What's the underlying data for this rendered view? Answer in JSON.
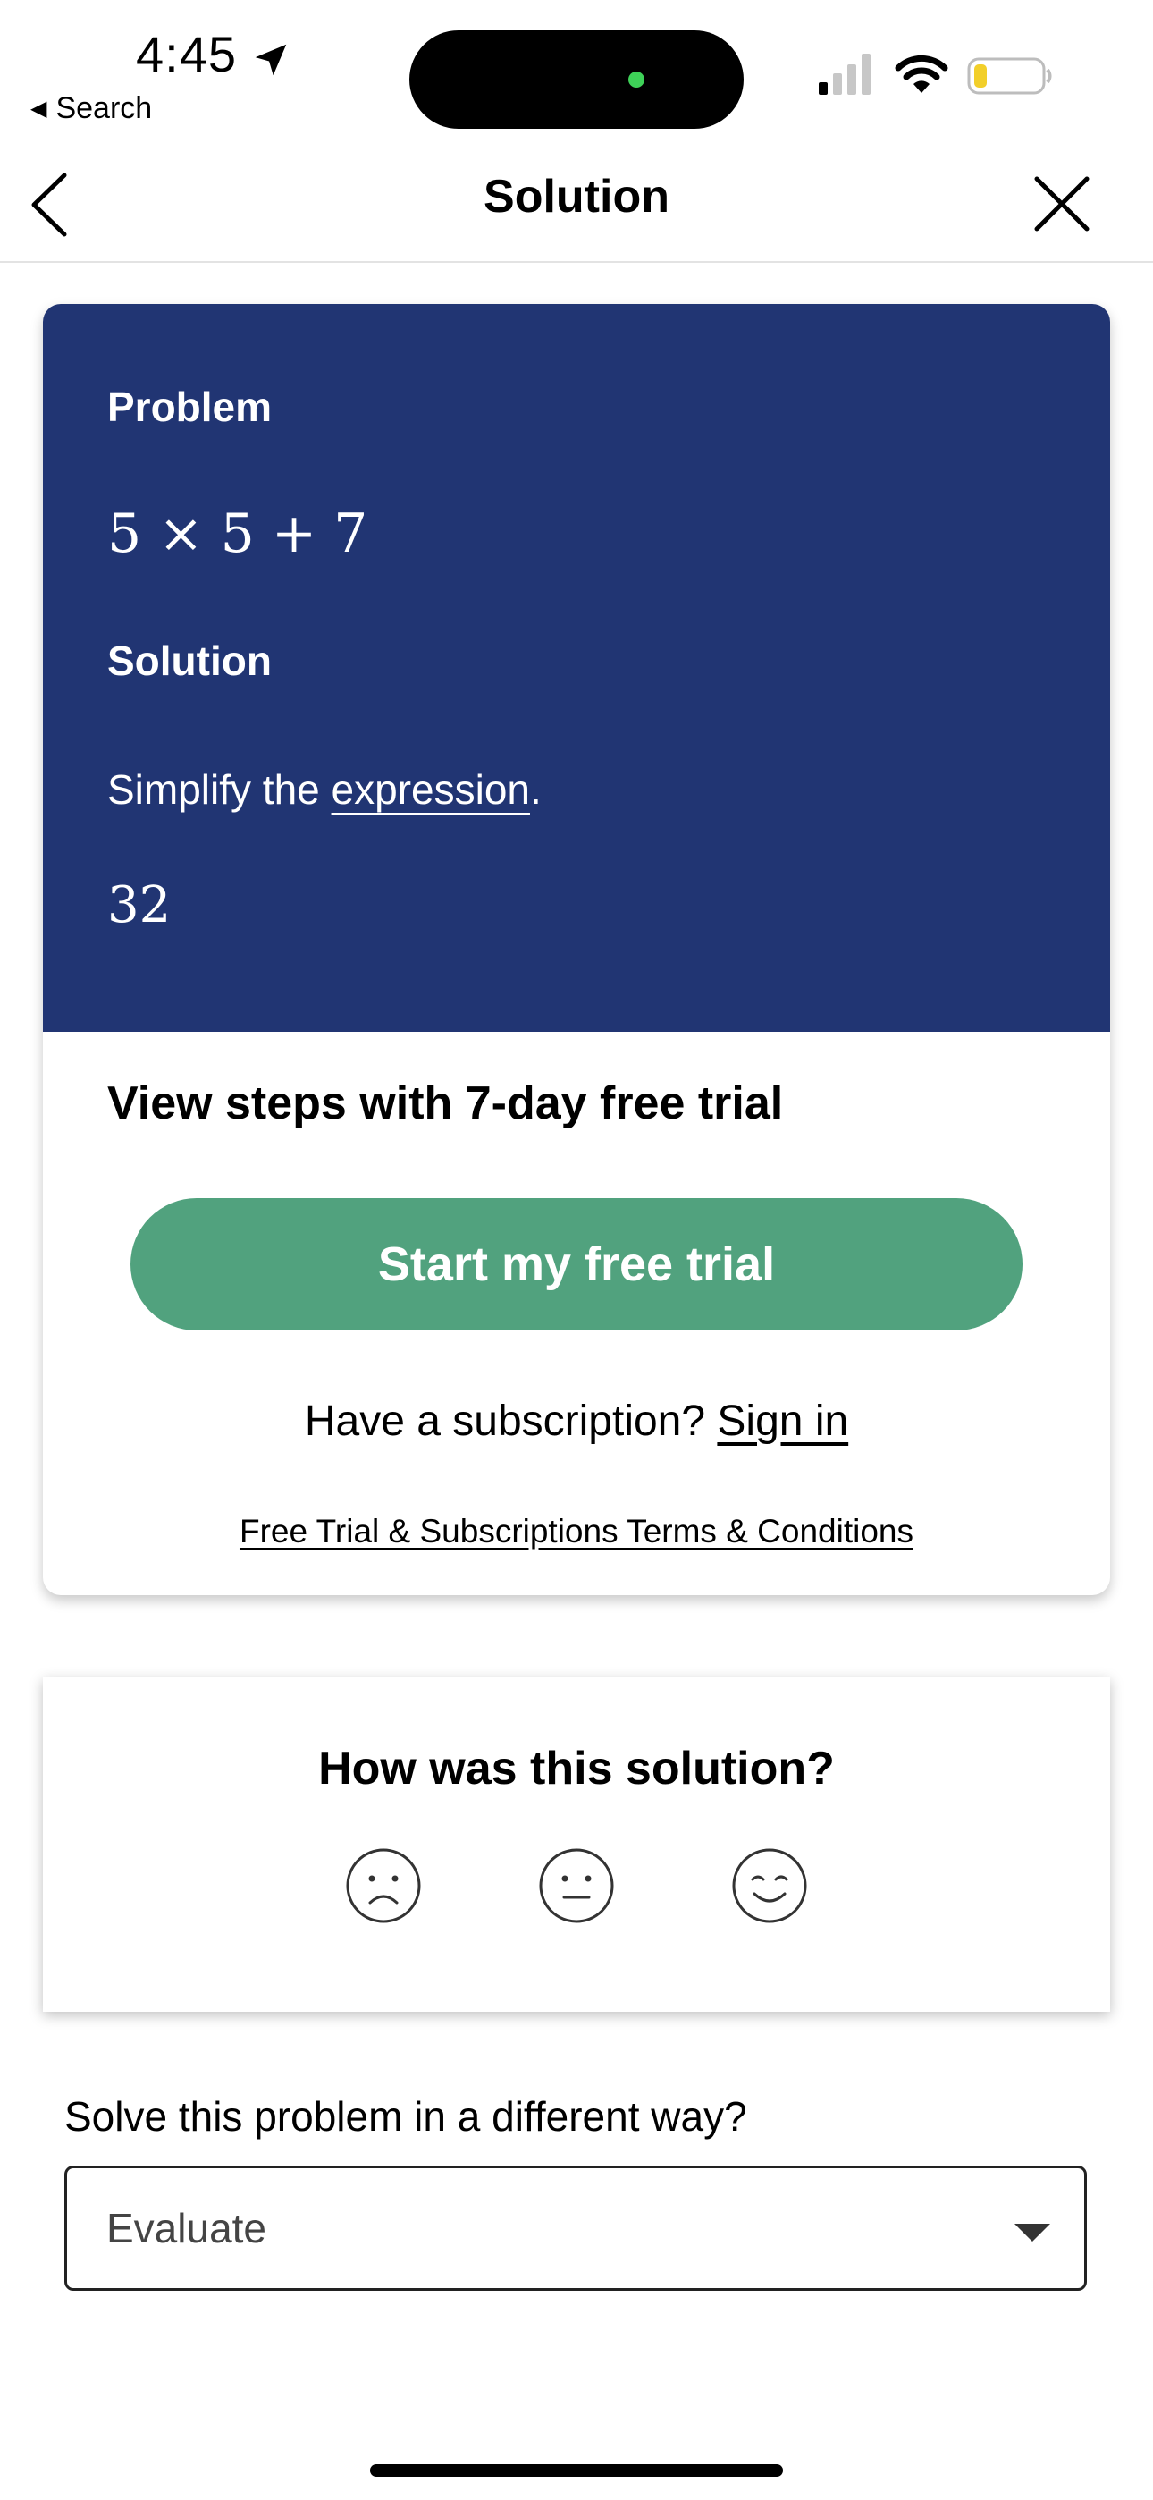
{
  "status_bar": {
    "time": "4:45",
    "back_label": "Search"
  },
  "navbar": {
    "title": "Solution"
  },
  "solution_card": {
    "problem_heading": "Problem",
    "expression": "5 × 5 + 7",
    "solution_heading": "Solution",
    "step_text_prefix": "Simplify the ",
    "step_text_link": "expression",
    "step_text_suffix": ".",
    "answer": "32",
    "cta_heading": "View steps with 7-day free trial",
    "trial_button": "Start my free trial",
    "subscription_prompt": "Have a subscription? ",
    "sign_in_link": "Sign in",
    "terms_link": "Free Trial & Subscriptions Terms & Conditions"
  },
  "rating": {
    "title": "How was this solution?",
    "faces": [
      "sad-face-icon",
      "neutral-face-icon",
      "happy-face-icon"
    ]
  },
  "alternate_method": {
    "question": "Solve this problem in a different way?",
    "selected": "Evaluate"
  },
  "colors": {
    "card_header": "#213573",
    "trial_button": "#51a27e",
    "battery_level": "#f2cf2a"
  }
}
